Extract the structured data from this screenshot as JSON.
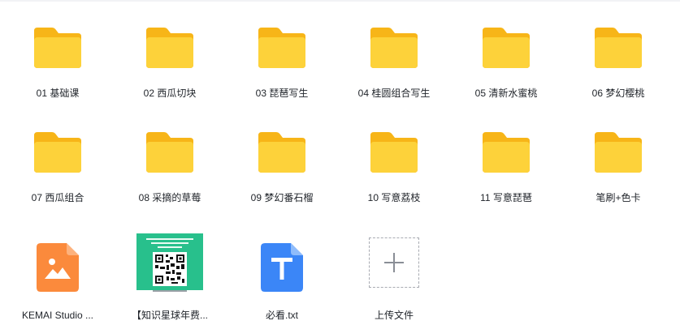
{
  "files": {
    "row1": [
      {
        "name": "01 基础课"
      },
      {
        "name": "02 西瓜切块"
      },
      {
        "name": "03 琵琶写生"
      },
      {
        "name": "04 桂圆组合写生"
      },
      {
        "name": "05 清新水蜜桃"
      },
      {
        "name": "06 梦幻樱桃"
      }
    ],
    "row2": [
      {
        "name": "07 西瓜组合"
      },
      {
        "name": "08 采摘的草莓"
      },
      {
        "name": "09 梦幻番石榴"
      },
      {
        "name": "10 写意荔枝"
      },
      {
        "name": "11 写意琵琶"
      },
      {
        "name": "笔刷+色卡"
      }
    ],
    "row3": [
      {
        "name": "KEMAI Studio ..."
      },
      {
        "name": "【知识星球年费..."
      },
      {
        "name": "必看.txt"
      },
      {
        "name": "上传文件"
      }
    ]
  },
  "colors": {
    "folder_back": "#f7b518",
    "folder_front": "#fdd23a",
    "image_file": "#fb8a3c",
    "txt_file": "#3b86f7",
    "qr_green": "#28c08c"
  },
  "icons": {
    "folder": "folder-icon",
    "image": "image-file-icon",
    "text": "text-file-icon",
    "upload": "plus-icon"
  }
}
